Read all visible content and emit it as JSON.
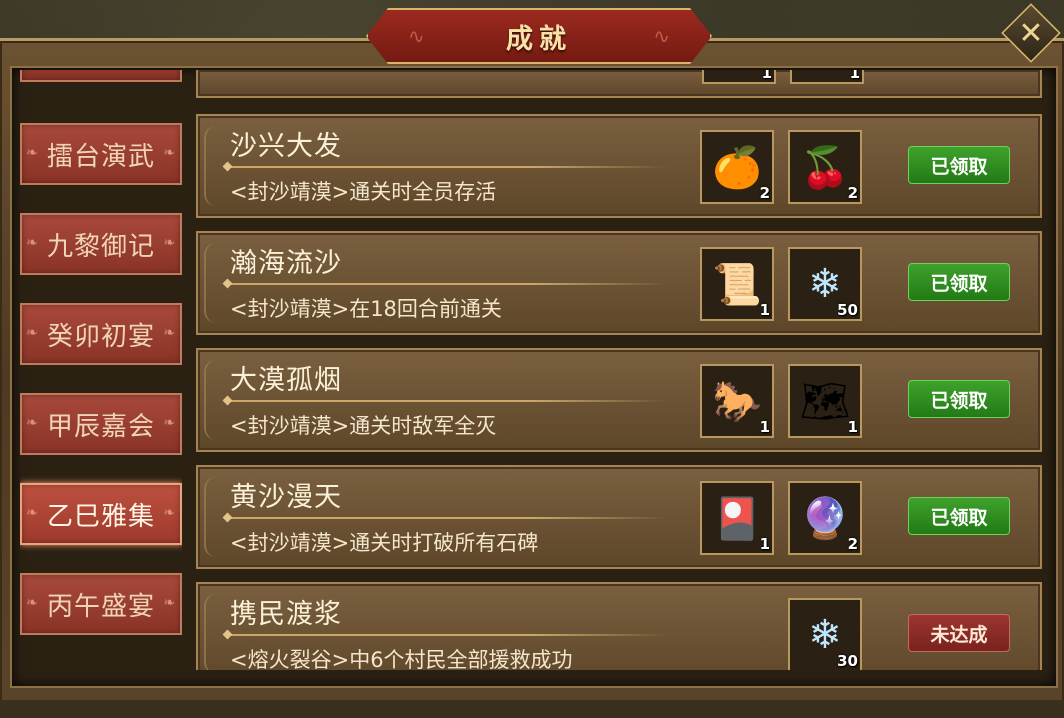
{
  "title": "成就",
  "close_icon": "✕",
  "sidebar": {
    "tabs": [
      {
        "label": "擂台演武",
        "active": false
      },
      {
        "label": "九黎御记",
        "active": false
      },
      {
        "label": "癸卯初宴",
        "active": false
      },
      {
        "label": "甲辰嘉会",
        "active": false
      },
      {
        "label": "乙巳雅集",
        "active": true
      },
      {
        "label": "丙午盛宴",
        "active": false
      }
    ]
  },
  "achievements": [
    {
      "name": "沙兴大发",
      "desc": "<封沙靖漠>通关时全员存活",
      "rewards": [
        {
          "icon": "orange-fruit-icon",
          "glyph": "🍊",
          "count": "2"
        },
        {
          "icon": "cherry-icon",
          "glyph": "🍒",
          "count": "2"
        }
      ],
      "status": "已领取",
      "status_type": "done"
    },
    {
      "name": "瀚海流沙",
      "desc": "<封沙靖漠>在18回合前通关",
      "rewards": [
        {
          "icon": "scroll-tube-icon",
          "glyph": "📜",
          "count": "1"
        },
        {
          "icon": "ice-crystal-icon",
          "glyph": "❄",
          "count": "50"
        }
      ],
      "status": "已领取",
      "status_type": "done"
    },
    {
      "name": "大漠孤烟",
      "desc": "<封沙靖漠>通关时敌军全灭",
      "rewards": [
        {
          "icon": "war-horse-icon",
          "glyph": "🐎",
          "count": "1"
        },
        {
          "icon": "map-scroll-icon",
          "glyph": "🗺",
          "count": "1"
        }
      ],
      "status": "已领取",
      "status_type": "done"
    },
    {
      "name": "黄沙漫天",
      "desc": "<封沙靖漠>通关时打破所有石碑",
      "rewards": [
        {
          "icon": "gold-card-icon",
          "glyph": "🎴",
          "count": "1"
        },
        {
          "icon": "rainbow-orb-icon",
          "glyph": "🔮",
          "count": "2"
        }
      ],
      "status": "已领取",
      "status_type": "done"
    },
    {
      "name": "携民渡浆",
      "desc": "<熔火裂谷>中6个村民全部援救成功",
      "rewards": [
        {
          "icon": "ice-crystal-icon",
          "glyph": "❄",
          "count": "30"
        }
      ],
      "status": "未达成",
      "status_type": "todo"
    }
  ],
  "partial_row_counts": [
    "1",
    "1"
  ]
}
